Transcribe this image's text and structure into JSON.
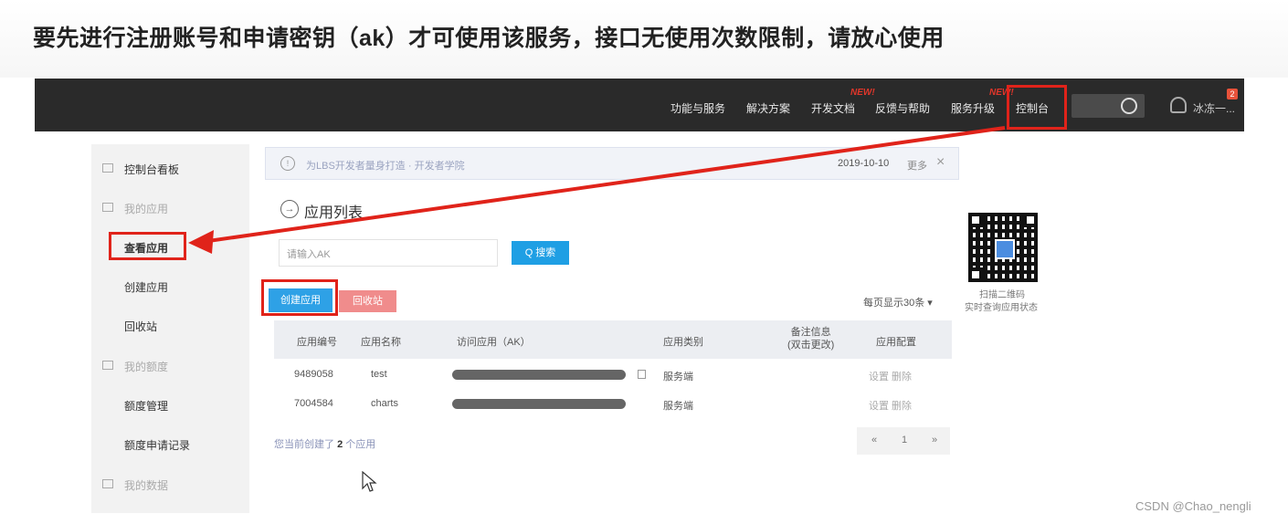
{
  "headline": "要先进行注册账号和申请密钥（ak）才可使用该服务，接口无使用次数限制，请放心使用",
  "topnav": {
    "items": [
      "功能与服务",
      "解决方案",
      "开发文档",
      "反馈与帮助",
      "服务升级",
      "控制台"
    ],
    "new_tags": [
      "NEW!",
      "NEW!"
    ],
    "user": "冰冻一...",
    "badge": "2"
  },
  "sidebar": {
    "items": [
      "控制台看板",
      "我的应用",
      "查看应用",
      "创建应用",
      "回收站",
      "我的额度",
      "额度管理",
      "额度申请记录",
      "我的数据"
    ]
  },
  "notice": {
    "text": "为LBS开发者量身打造 · 开发者学院",
    "date": "2019-10-10",
    "more": "更多",
    "close": "×"
  },
  "section": {
    "icon": "→",
    "title": "应用列表"
  },
  "search": {
    "placeholder": "请输入AK",
    "button": "Q 搜索"
  },
  "actions": {
    "create": "创建应用",
    "recycle": "回收站",
    "per_page": "每页显示30条 ▾"
  },
  "table": {
    "headers": [
      "应用编号",
      "应用名称",
      "访问应用（AK）",
      "应用类别",
      "备注信息\n(双击更改)",
      "应用配置"
    ],
    "rows": [
      {
        "id": "9489058",
        "name": "test",
        "type": "服务端",
        "config": "设置 删除"
      },
      {
        "id": "7004584",
        "name": "charts",
        "type": "服务端",
        "config": "设置 删除"
      }
    ]
  },
  "footer": {
    "prefix": "您当前创建了",
    "count": "2",
    "suffix": "个应用"
  },
  "pager": {
    "prev": "«",
    "page": "1",
    "next": "»"
  },
  "qr": {
    "caption1": "扫描二维码",
    "caption2": "实时查询应用状态"
  },
  "watermark": "CSDN @Chao_nengli"
}
